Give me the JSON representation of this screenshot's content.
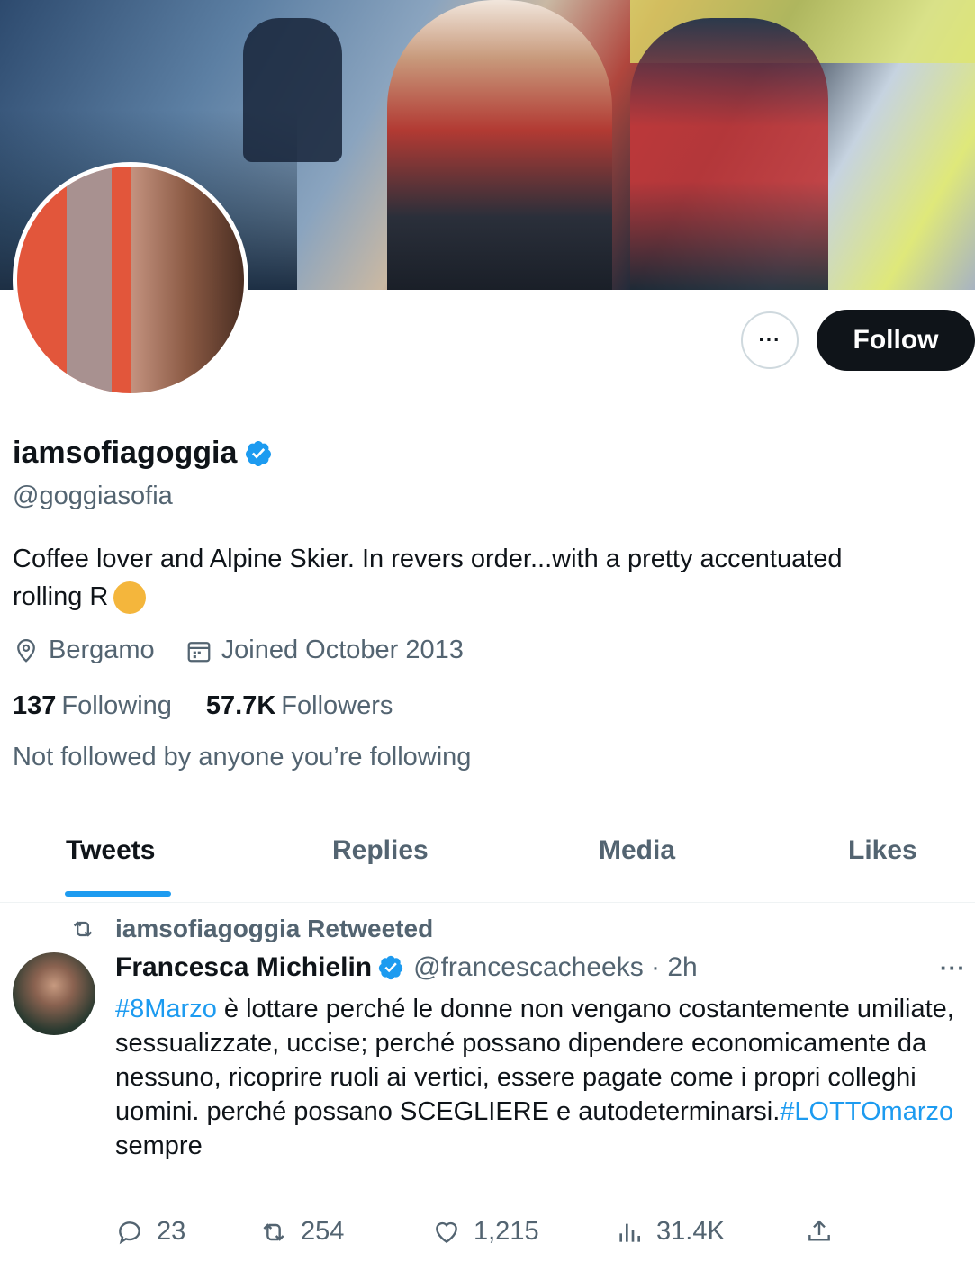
{
  "profile": {
    "display_name": "iamsofiagoggia",
    "handle": "@goggiasofia",
    "bio": "Coffee lover and Alpine Skier. In revers order...with a pretty accentuated rolling R",
    "location": "Bergamo",
    "joined": "Joined October 2013",
    "following_count": "137",
    "following_label": "Following",
    "followers_count": "57.7K",
    "followers_label": "Followers",
    "not_followed": "Not followed by anyone you’re following"
  },
  "actions": {
    "more": "···",
    "follow": "Follow"
  },
  "tabs": [
    {
      "label": "Tweets",
      "active": true
    },
    {
      "label": "Replies",
      "active": false
    },
    {
      "label": "Media",
      "active": false
    },
    {
      "label": "Likes",
      "active": false
    }
  ],
  "tweet": {
    "retweeted_by": "iamsofiagoggia Retweeted",
    "author": "Francesca Michielin",
    "handle_time": "@francescacheeks · 2h",
    "more": "···",
    "hashtag1": "#8Marzo",
    "text_main": " è lottare perché le donne non vengano costantemente umiliate, sessualizzate, uccise; perché possano dipendere economicamente da nessuno, ricoprire ruoli ai vertici, essere pagate come i propri colleghi uomini. perché possano SCEGLIERE e autodeterminarsi.",
    "hashtag2": "#LOTTOmarzo",
    "text_end": " sempre",
    "replies": "23",
    "retweets": "254",
    "likes": "1,215",
    "views": "31.4K"
  },
  "colors": {
    "accent": "#1d9bf0",
    "text_primary": "#0f1419",
    "text_secondary": "#536471"
  },
  "icons": {
    "verified": "verified-badge-icon",
    "location": "location-pin-icon",
    "calendar": "calendar-icon",
    "retweet": "retweet-icon",
    "reply": "reply-icon",
    "like": "heart-icon",
    "views": "views-chart-icon",
    "share": "share-icon"
  }
}
